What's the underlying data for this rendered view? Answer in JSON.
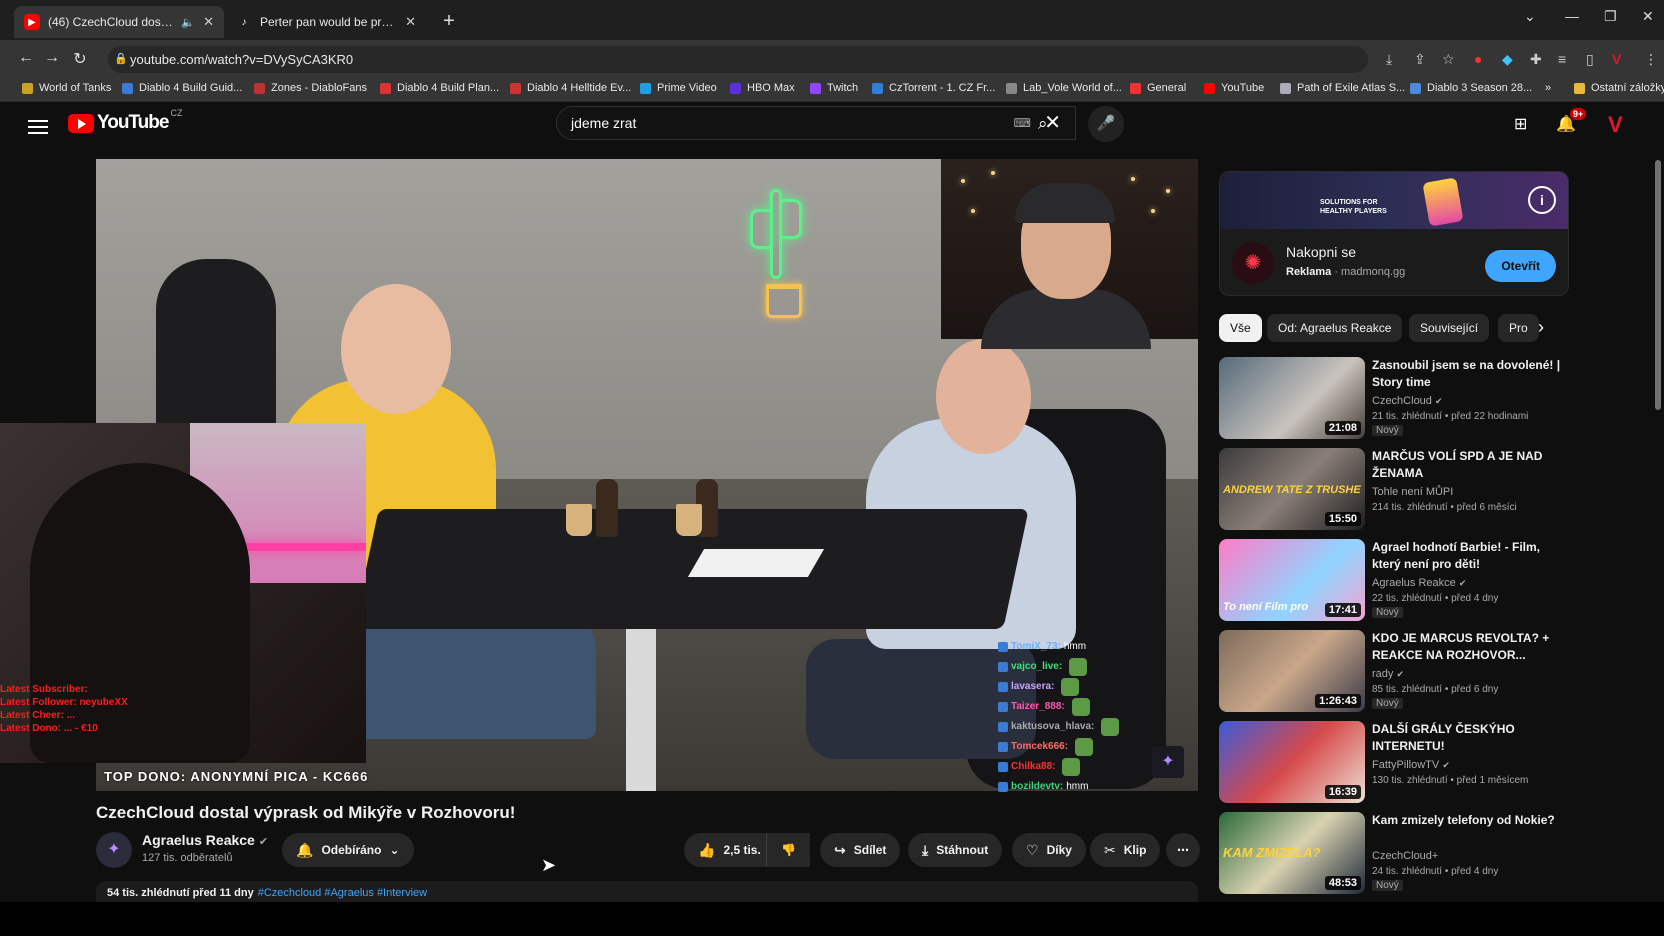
{
  "browser": {
    "tabs": [
      {
        "label": "(46) CzechCloud dostal výpr",
        "active": true
      },
      {
        "label": "Perter pan would be proud of m",
        "active": false
      }
    ],
    "url": "youtube.com/watch?v=DVySyCA3KR0",
    "bookmarks": [
      {
        "label": "World of Tanks",
        "color": "#c9a227"
      },
      {
        "label": "Diablo 4 Build Guid...",
        "color": "#3d7ad6"
      },
      {
        "label": "Zones - DiabloFans",
        "color": "#b33"
      },
      {
        "label": "Diablo 4 Build Plan...",
        "color": "#d33"
      },
      {
        "label": "Diablo 4 Helltide Ev...",
        "color": "#c33"
      },
      {
        "label": "Prime Video",
        "color": "#1fa0e0"
      },
      {
        "label": "HBO Max",
        "color": "#5b2fd9"
      },
      {
        "label": "Twitch",
        "color": "#9147ff"
      },
      {
        "label": "CzTorrent - 1. CZ Fr...",
        "color": "#2f7fd6"
      },
      {
        "label": "Lab_Vole World of...",
        "color": "#888"
      },
      {
        "label": "General",
        "color": "#e33"
      },
      {
        "label": "YouTube",
        "color": "#ff0000"
      },
      {
        "label": "Path of Exile Atlas S...",
        "color": "#aab"
      },
      {
        "label": "Diablo 3 Season 28...",
        "color": "#4a8ad6"
      },
      {
        "label": "Ostatní záložky",
        "color": "#e8b93e"
      }
    ]
  },
  "header": {
    "logo_text": "YouTube",
    "logo_region": "CZ",
    "search_value": "jdeme zrat",
    "notif_count": "9+"
  },
  "player": {
    "top_dono": "TOP DONO: ANONYMNÍ  PICA - KC666",
    "overlay_lines": [
      "Latest Subscriber:",
      "Latest Follower: neyubeXX",
      "Latest Cheer: ...",
      "Latest Dono: ... - €10"
    ],
    "chat": [
      {
        "user": "TomiX_73:",
        "text": "hmm",
        "color": "#6ab0ff",
        "emote": false
      },
      {
        "user": "vajco_live:",
        "text": "",
        "color": "#3fe07a",
        "emote": true
      },
      {
        "user": "lavasera:",
        "text": "",
        "color": "#c8a2ff",
        "emote": true
      },
      {
        "user": "Taizer_888:",
        "text": "",
        "color": "#ff5ab0",
        "emote": true
      },
      {
        "user": "kaktusova_hlava:",
        "text": "",
        "color": "#aaa",
        "emote": true
      },
      {
        "user": "Tomcek666:",
        "text": "",
        "color": "#ff6b6b",
        "emote": true
      },
      {
        "user": "Chilka88:",
        "text": "",
        "color": "#ff3030",
        "emote": true
      },
      {
        "user": "bozildevtv:",
        "text": "hmm",
        "color": "#43d17f",
        "emote": false
      }
    ]
  },
  "video": {
    "title": "CzechCloud dostal výprask od Mikýře v Rozhovoru!",
    "channel": "Agraelus Reakce",
    "subscribers": "127 tis. odběratelů",
    "subscribe_label": "Odebíráno",
    "likes": "2,5 tis.",
    "share_label": "Sdílet",
    "download_label": "Stáhnout",
    "thanks_label": "Díky",
    "clip_label": "Klip",
    "views_date": "54 tis. zhlédnutí  před 11 dny",
    "hashtags": "#Czechcloud #Agraelus #Interview"
  },
  "ad": {
    "banner_text": "SOLUTIONS FOR HEALTHY PLAYERS",
    "title": "Nakopni se",
    "label": "Reklama",
    "domain": "madmonq.gg",
    "button": "Otevřít"
  },
  "chips": [
    "Vše",
    "Od: Agraelus Reakce",
    "Související",
    "Pro"
  ],
  "recommendations": [
    {
      "title": "Zasnoubil jsem se na dovolené! | Story time",
      "channel": "CzechCloud",
      "verified": true,
      "meta": "21 tis. zhlédnutí • před 22 hodinami",
      "new": "Nový",
      "duration": "21:08",
      "thumb_text": ""
    },
    {
      "title": "MARČUS VOLÍ SPD A JE NAD ŽENAMA",
      "channel": "Tohle není MŮPI",
      "verified": false,
      "meta": "214 tis. zhlédnutí • před 6 měsíci",
      "new": "",
      "duration": "15:50",
      "thumb_text": "ANDREW TATE Z TRUSHE"
    },
    {
      "title": "Agrael hodnotí Barbie! - Film, který není pro děti!",
      "channel": "Agraelus Reakce",
      "verified": true,
      "meta": "22 tis. zhlédnutí • před 4 dny",
      "new": "Nový",
      "duration": "17:41",
      "thumb_text": "To není Film pro"
    },
    {
      "title": "KDO JE MARCUS REVOLTA? + REAKCE NA ROZHOVOR...",
      "channel": "rady",
      "verified": true,
      "meta": "85 tis. zhlédnutí • před 6 dny",
      "new": "Nový",
      "duration": "1:26:43",
      "thumb_text": ""
    },
    {
      "title": "DALŠÍ GRÁLY ČESKÝHO INTERNETU!",
      "channel": "FattyPillowTV",
      "verified": true,
      "meta": "130 tis. zhlédnutí • před 1 měsícem",
      "new": "",
      "duration": "16:39",
      "thumb_text": ""
    },
    {
      "title": "Kam zmizely telefony od Nokie?",
      "channel": "CzechCloud+",
      "verified": false,
      "meta": "24 tis. zhlédnutí • před 4 dny",
      "new": "Nový",
      "duration": "48:53",
      "thumb_text": "KAM ZMIZELA?"
    }
  ]
}
